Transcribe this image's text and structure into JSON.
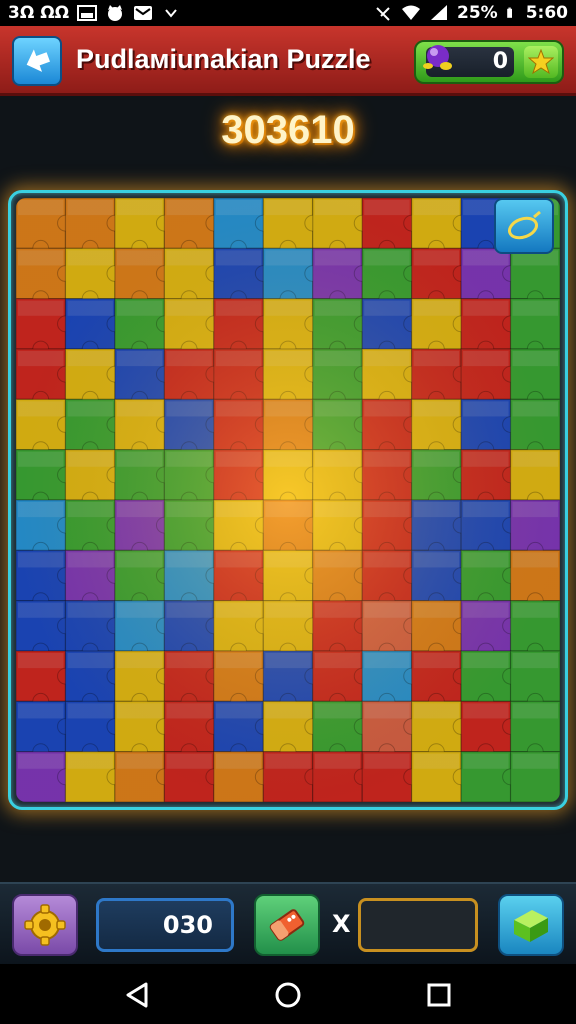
{
  "status_bar": {
    "left_text": "3Ω ΩΩ",
    "battery": "25%",
    "time": "5:60"
  },
  "header": {
    "title": "Pudlaмiunakian Puzzle",
    "currency_value": "0",
    "back_icon": "back-arrow-icon",
    "currency_icon": "candy-icon",
    "plus_icon": "plus-star-icon"
  },
  "score": "303610",
  "board": {
    "rows": 12,
    "cols": 11,
    "hint_icon": "lemon-hint-icon",
    "palette": {
      "R": "#e02a22",
      "Y": "#f5c814",
      "O": "#f08a1c",
      "G": "#3fb338",
      "B": "#1f4fd0",
      "L": "#2aa0e6",
      "P": "#8a3cc8",
      "K": "#e8684a"
    },
    "tiles": [
      [
        "O",
        "O",
        "Y",
        "O",
        "L",
        "Y",
        "Y",
        "R",
        "Y",
        "B",
        "G"
      ],
      [
        "O",
        "Y",
        "O",
        "Y",
        "B",
        "L",
        "P",
        "G",
        "R",
        "P",
        "G"
      ],
      [
        "R",
        "B",
        "G",
        "Y",
        "R",
        "Y",
        "G",
        "B",
        "Y",
        "R",
        "G"
      ],
      [
        "R",
        "Y",
        "B",
        "R",
        "R",
        "Y",
        "G",
        "Y",
        "R",
        "R",
        "G"
      ],
      [
        "Y",
        "G",
        "Y",
        "B",
        "R",
        "O",
        "G",
        "R",
        "Y",
        "B",
        "G"
      ],
      [
        "G",
        "Y",
        "G",
        "G",
        "R",
        "Y",
        "Y",
        "R",
        "G",
        "R",
        "Y"
      ],
      [
        "L",
        "G",
        "P",
        "G",
        "Y",
        "O",
        "Y",
        "R",
        "B",
        "B",
        "P"
      ],
      [
        "B",
        "P",
        "G",
        "L",
        "R",
        "Y",
        "O",
        "R",
        "B",
        "G",
        "O"
      ],
      [
        "B",
        "B",
        "L",
        "B",
        "Y",
        "Y",
        "R",
        "K",
        "O",
        "P",
        "G"
      ],
      [
        "R",
        "B",
        "Y",
        "R",
        "O",
        "B",
        "R",
        "L",
        "R",
        "G",
        "G"
      ],
      [
        "B",
        "B",
        "Y",
        "R",
        "B",
        "Y",
        "G",
        "K",
        "Y",
        "R",
        "G"
      ],
      [
        "P",
        "Y",
        "O",
        "R",
        "O",
        "R",
        "R",
        "R",
        "Y",
        "G",
        "G"
      ]
    ]
  },
  "bottom_bar": {
    "settings_icon": "gear-icon",
    "count_value": "030",
    "eraser_icon": "eraser-icon",
    "multiplier": "X",
    "progress": 0,
    "block_icon": "green-block-icon"
  },
  "navbar": {
    "back_icon": "nav-back-icon",
    "home_icon": "nav-home-icon",
    "recents_icon": "nav-recents-icon"
  }
}
